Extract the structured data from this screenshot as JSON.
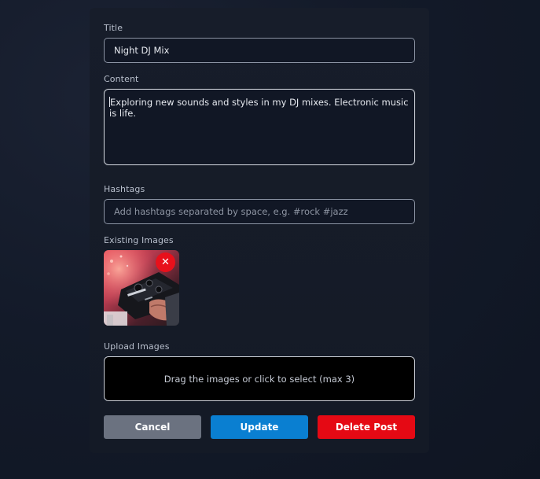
{
  "form": {
    "title_label": "Title",
    "title_value": "Night DJ Mix",
    "content_label": "Content",
    "content_value": "Exploring new sounds and styles in my DJ mixes. Electronic music is life.",
    "hashtags_label": "Hashtags",
    "hashtags_placeholder": "Add hashtags separated by space, e.g. #rock #jazz",
    "existing_images_label": "Existing Images",
    "remove_glyph": "✕",
    "upload_label": "Upload Images",
    "upload_prompt": "Drag the images or click to select (max 3)"
  },
  "actions": {
    "cancel_label": "Cancel",
    "update_label": "Update",
    "delete_label": "Delete Post"
  },
  "colors": {
    "update": "#0a7fd1",
    "delete": "#e50914",
    "cancel": "#6b7280"
  },
  "icons": {
    "remove": "close-icon"
  }
}
